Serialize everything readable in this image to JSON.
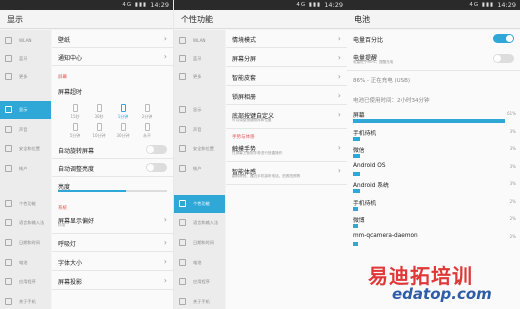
{
  "status": {
    "time": "14:29",
    "signal": "4G ▮▮▮"
  },
  "sidebar": [
    {
      "label": "WLAN",
      "icon": "wifi-icon"
    },
    {
      "label": "蓝牙",
      "icon": "bluetooth-icon"
    },
    {
      "label": "更多",
      "icon": "more-icon"
    },
    {
      "label": "显示",
      "icon": "display-icon"
    },
    {
      "label": "声音",
      "icon": "sound-icon"
    },
    {
      "label": "安全和位置",
      "icon": "security-icon"
    },
    {
      "label": "帐户",
      "icon": "account-icon"
    },
    {
      "label": "个性功能",
      "icon": "personal-icon"
    },
    {
      "label": "语言和输入法",
      "icon": "language-icon"
    },
    {
      "label": "日期和时间",
      "icon": "clock-icon"
    },
    {
      "label": "电池",
      "icon": "battery-icon"
    },
    {
      "label": "应用程序",
      "icon": "apps-icon"
    },
    {
      "label": "关于手机",
      "icon": "phone-icon"
    }
  ],
  "display": {
    "title": "显示",
    "wallpaper": "壁纸",
    "notification": "通知中心",
    "section_screen": "屏幕",
    "timeout": "屏幕超时",
    "timeouts": [
      "15秒",
      "30秒",
      "1分钟",
      "2分钟",
      "5分钟",
      "10分钟",
      "30分钟",
      "永不"
    ],
    "auto_rotate": "自动旋转屏幕",
    "auto_brightness": "自动调整亮度",
    "brightness": "亮度",
    "section_system": "系统",
    "pref": "屏幕显示偏好",
    "pref_sub": "标准",
    "breath": "呼吸灯",
    "font": "字体大小",
    "cast": "屏幕投影"
  },
  "personal": {
    "title": "个性功能",
    "items": [
      "情境模式",
      "屏幕分屏",
      "智能皮套",
      "锁屏相册",
      "底部按键自定义"
    ],
    "custom_sub": "可以调整按键顺序和位置",
    "section_gesture": "手势与体感",
    "touch": "触摸手势",
    "touch_sub": "在屏幕上使用手势进行快捷操作",
    "motion": "智能体感",
    "motion_sub": "翻转静音、靠近手机接听电话、拍照拍照等"
  },
  "battery": {
    "title": "电池",
    "percent": "电量百分比",
    "alert": "电量提醒",
    "alert_sub": "电量低于80%，提醒充电",
    "status": "86% - 正在充电 (USB)",
    "used": "电池已使用时间：2小时34分钟",
    "usage": [
      {
        "name": "屏幕",
        "pct": "61%",
        "value": 61
      },
      {
        "name": "手机待机",
        "pct": "3%",
        "value": 3
      },
      {
        "name": "微信",
        "pct": "3%",
        "value": 3
      },
      {
        "name": "Android OS",
        "pct": "3%",
        "value": 3
      },
      {
        "name": "Android 系统",
        "pct": "3%",
        "value": 3
      },
      {
        "name": "手机待机",
        "pct": "2%",
        "value": 2
      },
      {
        "name": "微博",
        "pct": "2%",
        "value": 2
      },
      {
        "name": "mm-qcamera-daemon",
        "pct": "2%",
        "value": 2
      }
    ]
  },
  "watermark": {
    "line1": "易迪拓培训",
    "line2": "edatop.com"
  },
  "colors": {
    "accent": "#2fa8d8",
    "section": "#e05555"
  }
}
